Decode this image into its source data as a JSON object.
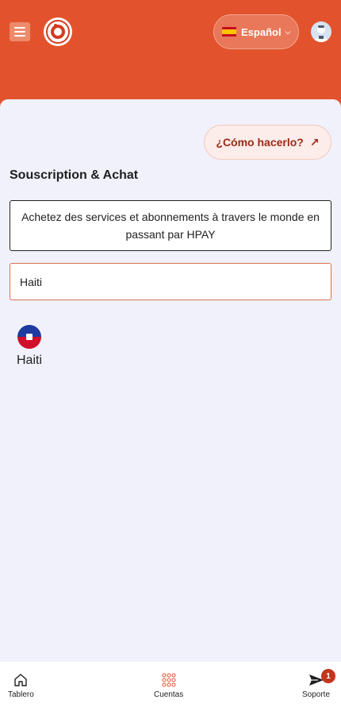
{
  "header": {
    "language_label": "Español",
    "language_flag": "flag-es-icon"
  },
  "main": {
    "how_to_label": "¿Cómo hacerlo?",
    "how_to_icon": "↗",
    "section_title": "Souscription & Achat",
    "info_text": "Achetez des services et abonnements à travers le monde en passant par HPAY",
    "search": {
      "value": "Haiti"
    },
    "countries": [
      {
        "name": "Haiti",
        "flag": "flag-haiti-icon"
      }
    ]
  },
  "bottom_nav": {
    "items": [
      {
        "label": "Tablero",
        "icon": "home-icon"
      },
      {
        "label": "Cuentas",
        "icon": "grid-icon"
      },
      {
        "label": "Soporte",
        "icon": "send-icon",
        "badge": "1"
      }
    ]
  },
  "colors": {
    "brand": "#e2532d",
    "background": "#f0f1fb",
    "badge": "#c3351d"
  }
}
